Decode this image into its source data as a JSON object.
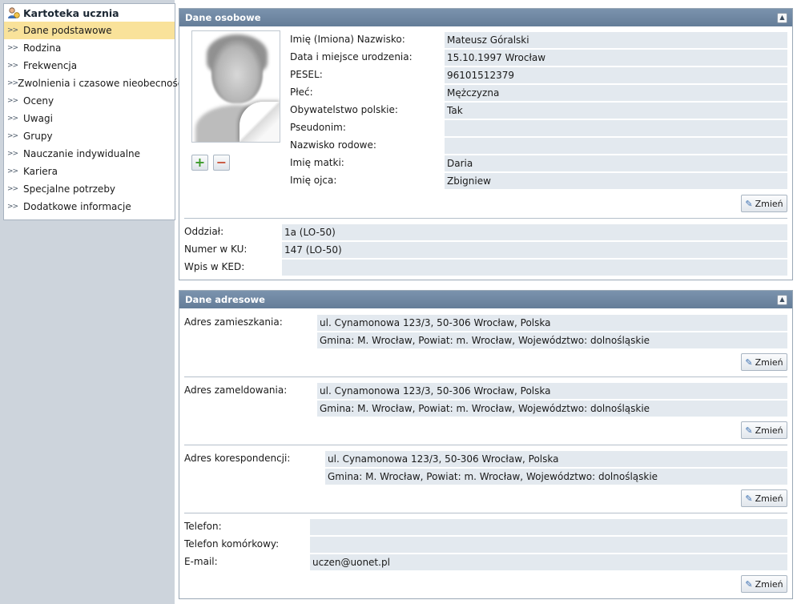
{
  "sidebar": {
    "title": "Kartoteka ucznia",
    "items": [
      {
        "label": "Dane podstawowe",
        "active": true
      },
      {
        "label": "Rodzina"
      },
      {
        "label": "Frekwencja"
      },
      {
        "label": "Zwolnienia i czasowe nieobecności"
      },
      {
        "label": "Oceny"
      },
      {
        "label": "Uwagi"
      },
      {
        "label": "Grupy"
      },
      {
        "label": "Nauczanie indywidualne"
      },
      {
        "label": "Kariera"
      },
      {
        "label": "Specjalne potrzeby"
      },
      {
        "label": "Dodatkowe informacje"
      }
    ]
  },
  "personal": {
    "title": "Dane osobowe",
    "fields": [
      {
        "label": "Imię (Imiona) Nazwisko:",
        "value": "Mateusz Góralski"
      },
      {
        "label": "Data i miejsce urodzenia:",
        "value": "15.10.1997 Wrocław"
      },
      {
        "label": "PESEL:",
        "value": "96101512379"
      },
      {
        "label": "Płeć:",
        "value": "Mężczyzna"
      },
      {
        "label": "Obywatelstwo polskie:",
        "value": "Tak"
      },
      {
        "label": "Pseudonim:",
        "value": ""
      },
      {
        "label": "Nazwisko rodowe:",
        "value": ""
      },
      {
        "label": "Imię matki:",
        "value": "Daria"
      },
      {
        "label": "Imię ojca:",
        "value": "Zbigniew"
      }
    ],
    "add_photo": "+",
    "remove_photo": "−",
    "edit_label": "Zmień",
    "school": [
      {
        "label": "Oddział:",
        "value": "1a (LO-50)"
      },
      {
        "label": "Numer w KU:",
        "value": "147 (LO-50)"
      },
      {
        "label": "Wpis w KED:",
        "value": ""
      }
    ]
  },
  "address": {
    "title": "Dane adresowe",
    "edit_label": "Zmień",
    "home": {
      "label": "Adres zamieszkania:",
      "line1": "ul. Cynamonowa 123/3, 50-306 Wrocław, Polska",
      "line2": "Gmina: M. Wrocław, Powiat: m. Wrocław, Województwo: dolnośląskie"
    },
    "registered": {
      "label": "Adres zameldowania:",
      "line1": "ul. Cynamonowa 123/3, 50-306 Wrocław, Polska",
      "line2": "Gmina: M. Wrocław, Powiat: m. Wrocław, Województwo: dolnośląskie"
    },
    "correspondence": {
      "label": "Adres korespondencji:",
      "line1": "ul. Cynamonowa 123/3, 50-306 Wrocław, Polska",
      "line2": "Gmina: M. Wrocław, Powiat: m. Wrocław, Województwo: dolnośląskie"
    },
    "contact": [
      {
        "label": "Telefon:",
        "value": ""
      },
      {
        "label": "Telefon komórkowy:",
        "value": ""
      },
      {
        "label": "E-mail:",
        "value": "uczen@uonet.pl"
      }
    ]
  },
  "icons": {
    "collapse": "double-chevron-up-icon",
    "edit": "pencil-icon",
    "user": "user-icon"
  }
}
